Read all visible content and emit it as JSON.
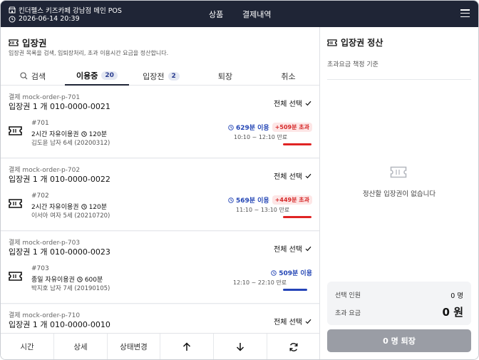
{
  "header": {
    "store_name": "킨더펠스 키즈카페 강남점 메인 POS",
    "datetime": "2026-06-14 20:39",
    "nav": [
      "상품",
      "결제내역"
    ],
    "menu_icon": "hamburger-icon",
    "bg_color": "#1f2536"
  },
  "left": {
    "title": "입장권",
    "subtitle": "입장권 목록을 검색, 입퇴장처리, 초과 이용시간 요금을 정산합니다.",
    "tabs": [
      {
        "label": "검색",
        "icon": "search-icon"
      },
      {
        "label": "이용중",
        "count": "20",
        "active": true
      },
      {
        "label": "입장전",
        "count": "2"
      },
      {
        "label": "퇴장"
      },
      {
        "label": "취소"
      }
    ],
    "orders": [
      {
        "order_label": "결제 mock-order-p-701",
        "order_title": "입장권 1 개 010-0000-0021",
        "select_all": "전체 선택",
        "ticket_no": "#701",
        "plan": "2시간 자유이용권",
        "duration": "120분",
        "person": "김도윤 남자 6세 (20200312)",
        "usage": "629분 이용",
        "over": "+509분 초과",
        "time_range": "10:10 ~ 12:10 만료",
        "usage_fraction": 1.0
      },
      {
        "order_label": "결제 mock-order-p-702",
        "order_title": "입장권 1 개 010-0000-0022",
        "select_all": "전체 선택",
        "ticket_no": "#702",
        "plan": "2시간 자유이용권",
        "duration": "120분",
        "person": "이서아 여자 5세 (20210720)",
        "usage": "569분 이용",
        "over": "+449분 초과",
        "time_range": "11:10 ~ 13:10 만료",
        "usage_fraction": 1.0
      },
      {
        "order_label": "결제 mock-order-p-703",
        "order_title": "입장권 1 개 010-0000-0023",
        "select_all": "전체 선택",
        "ticket_no": "#703",
        "plan": "종일 자유이용권",
        "duration": "600분",
        "person": "박지호 남자 7세 (20190105)",
        "usage": "509분 이용",
        "over": "",
        "time_range": "12:10 ~ 22:10 만료",
        "usage_fraction": 0.85
      },
      {
        "order_label": "결제 mock-order-p-710",
        "order_title": "입장권 1 개 010-0000-0010",
        "select_all": "전체 선택"
      }
    ],
    "bottom_actions": [
      {
        "label": "시간"
      },
      {
        "label": "상세"
      },
      {
        "label": "상태변경"
      },
      {
        "icon": "arrow-up-icon"
      },
      {
        "icon": "arrow-down-icon"
      },
      {
        "icon": "refresh-icon"
      }
    ]
  },
  "right": {
    "title": "입장권 정산",
    "basis": "초과요금 책정 기준",
    "empty_text": "정산할 입장권이 없습니다",
    "summary": {
      "people_label": "선택 인원",
      "people_value": "0 명",
      "fee_label": "초과 요금",
      "fee_value": "0 원"
    },
    "checkout_label": "0 명 퇴장"
  },
  "colors": {
    "accent_blue": "#2345b5",
    "over_red": "#d62a2a",
    "checkout_disabled": "#9a9da5"
  }
}
